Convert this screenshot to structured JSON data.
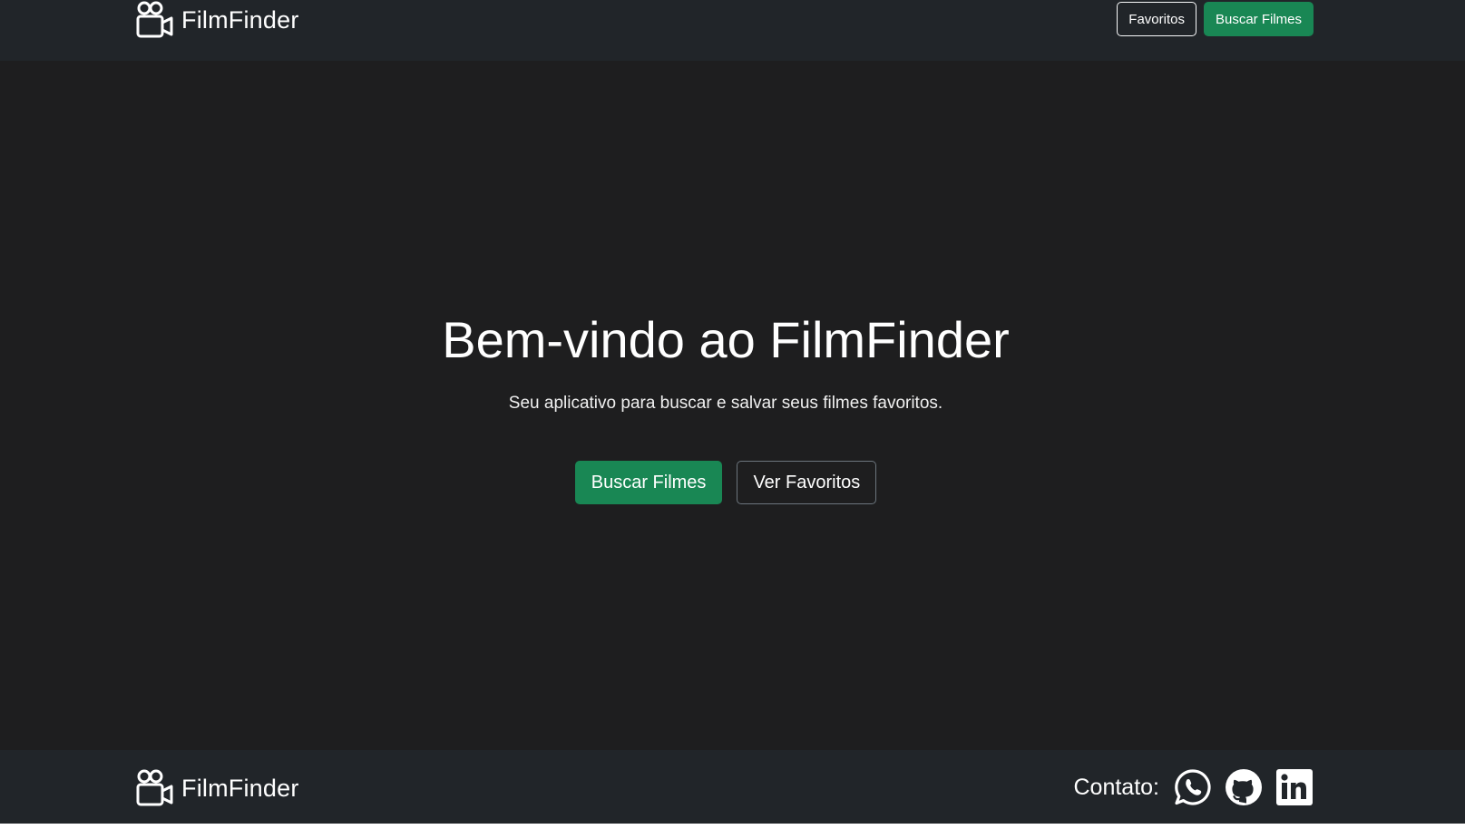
{
  "header": {
    "brand": "FilmFinder",
    "nav": {
      "favorites_label": "Favoritos",
      "search_label": "Buscar Filmes"
    }
  },
  "hero": {
    "title": "Bem-vindo ao FilmFinder",
    "subtitle": "Seu aplicativo para buscar e salvar seus filmes favoritos.",
    "primary_button": "Buscar Filmes",
    "secondary_button": "Ver Favoritos"
  },
  "footer": {
    "brand": "FilmFinder",
    "contact_label": "Contato:",
    "social": [
      "whatsapp-icon",
      "github-icon",
      "linkedin-icon"
    ]
  },
  "colors": {
    "background": "#1e1e1f",
    "navbar": "#212529",
    "success": "#198754",
    "text": "#ffffff"
  }
}
